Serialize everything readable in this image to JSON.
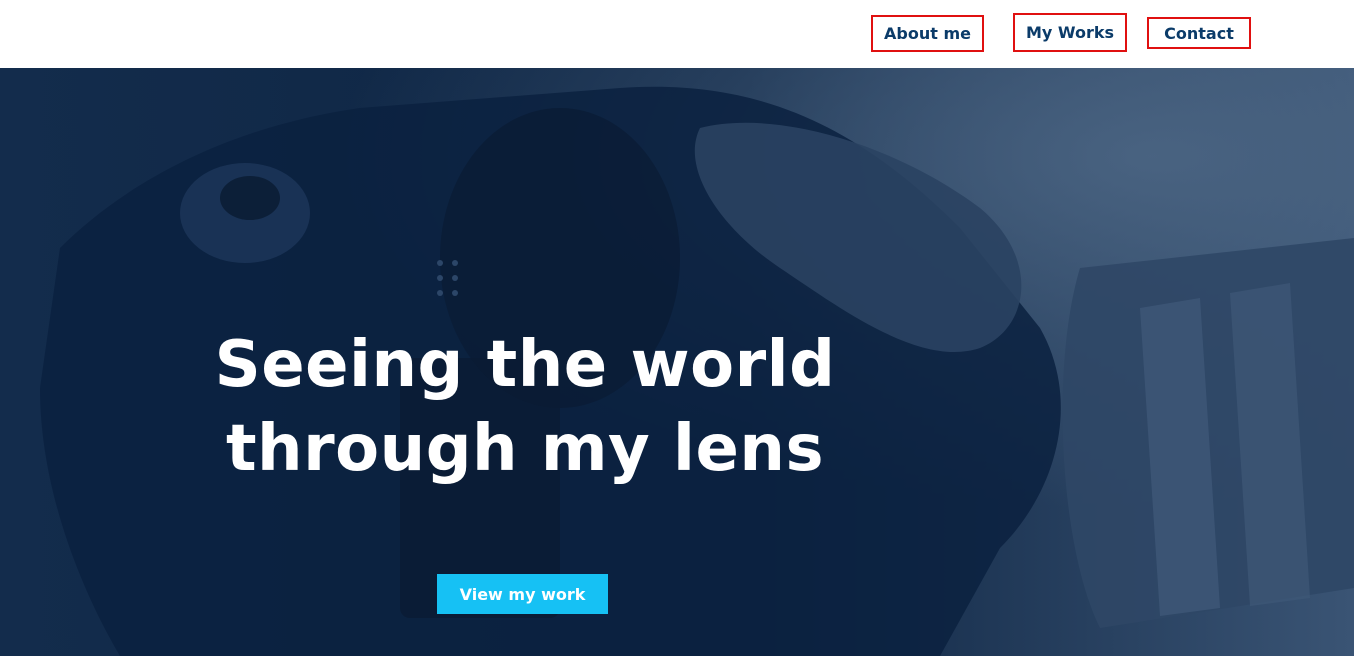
{
  "nav": {
    "about_label": "About me",
    "works_label": "My Works",
    "contact_label": "Contact"
  },
  "hero": {
    "headline_line1": "Seeing the world",
    "headline_line2": "through my lens",
    "cta_label": "View my work",
    "background_image": "camera-photo"
  },
  "colors": {
    "nav_text": "#0b3b69",
    "nav_border": "#e01010",
    "hero_overlay": "#0f2746",
    "cta_bg": "#16c1f4"
  }
}
